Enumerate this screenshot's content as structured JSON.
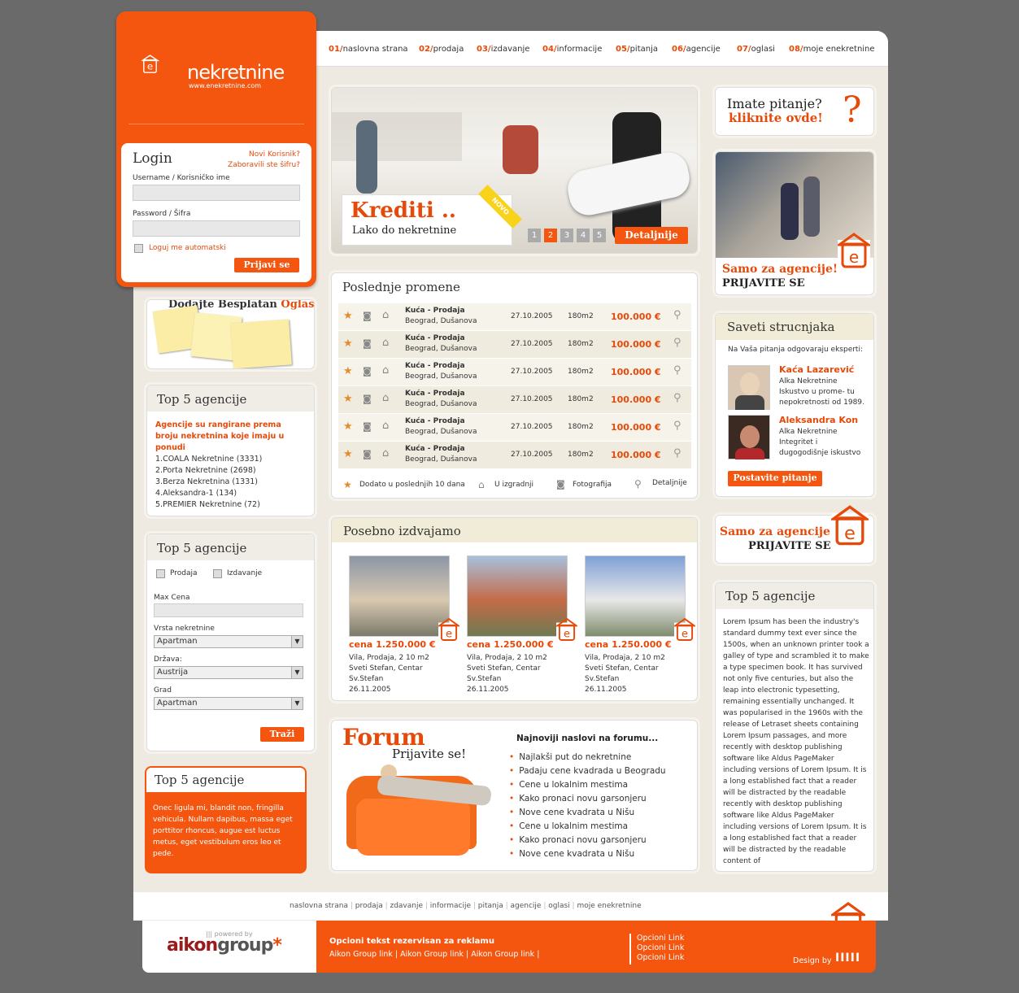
{
  "nav": [
    {
      "num": "01/",
      "label": "naslovna strana"
    },
    {
      "num": "02/",
      "label": "prodaja"
    },
    {
      "num": "03/",
      "label": "izdavanje"
    },
    {
      "num": "04/",
      "label": "informacije"
    },
    {
      "num": "05/",
      "label": "pitanja"
    },
    {
      "num": "06/",
      "label": "agencije"
    },
    {
      "num": "07/",
      "label": "oglasi"
    },
    {
      "num": "08/",
      "label": "moje enekretnine"
    }
  ],
  "logo": {
    "text": "nekretnine",
    "url": "www.enekretnine.com",
    "e": "e"
  },
  "login": {
    "title": "Login",
    "new_user": "Novi Korisnik?",
    "forgot": "Zaboravili ste šifru?",
    "username_label": "Username / Korisničko ime",
    "password_label": "Password / Šifra",
    "auto": "Loguj me automatski",
    "submit": "Prijavi se"
  },
  "ad": {
    "title1": "Dodajte Besplatan",
    "title2": "Oglas"
  },
  "top5a": {
    "title": "Top 5 agencije",
    "intro": "Agencije su rangirane prema broju nekretnina koje imaju u ponudi",
    "items": [
      "1.COALA Nekretnine (3331)",
      "2.Porta Nekretnine (2698)",
      "3.Berza Nekretnina (1331)",
      "4.Aleksandra-1 (134)",
      "5.PREMIER Nekretnine (72)"
    ]
  },
  "search": {
    "title": "Top 5 agencije",
    "prodaja": "Prodaja",
    "izdavanje": "Izdavanje",
    "max_cena": "Max Cena",
    "vrsta": "Vrsta nekretnine",
    "vrsta_val": "Apartman",
    "drzava": "Država:",
    "drzava_val": "Austrija",
    "grad": "Grad",
    "grad_val": "Apartman",
    "submit": "Traži"
  },
  "top5c": {
    "title": "Top 5 agencije",
    "text": "Onec ligula mi, blandit non, fringilla vehicula. Nullam dapibus, massa eget porttitor rhoncus, augue est luctus metus, eget vestibulum eros leo et pede."
  },
  "hero": {
    "title": "Krediti ..",
    "subtitle": "Lako do nekretnine",
    "badge": "NOVO",
    "pages": [
      "1",
      "2",
      "3",
      "4",
      "5"
    ],
    "details": "Detaljnije"
  },
  "latest": {
    "title": "Poslednje promene",
    "rows": [
      {
        "type": "Kuća - Prodaja",
        "loc": "Beograd, Dušanova",
        "date": "27.10.2005",
        "size": "180m2",
        "price": "100.000 €"
      },
      {
        "type": "Kuća - Prodaja",
        "loc": "Beograd, Dušanova",
        "date": "27.10.2005",
        "size": "180m2",
        "price": "100.000 €"
      },
      {
        "type": "Kuća - Prodaja",
        "loc": "Beograd, Dušanova",
        "date": "27.10.2005",
        "size": "180m2",
        "price": "100.000 €"
      },
      {
        "type": "Kuća - Prodaja",
        "loc": "Beograd, Dušanova",
        "date": "27.10.2005",
        "size": "180m2",
        "price": "100.000 €"
      },
      {
        "type": "Kuća - Prodaja",
        "loc": "Beograd, Dušanova",
        "date": "27.10.2005",
        "size": "180m2",
        "price": "100.000 €"
      },
      {
        "type": "Kuća - Prodaja",
        "loc": "Beograd, Dušanova",
        "date": "27.10.2005",
        "size": "180m2",
        "price": "100.000 €"
      }
    ],
    "legend": {
      "new": "Dodato u poslednjih 10 dana",
      "build": "U izgradnji",
      "photo": "Fotografija",
      "detail": "Detaljnije"
    }
  },
  "featured": {
    "title": "Posebno izdvajamo",
    "items": [
      {
        "price": "cena 1.250.000 €",
        "l1": "Vila, Prodaja, 2 10 m2",
        "l2": "Sveti Stefan, Centar",
        "l3": "Sv.Stefan",
        "l4": "26.11.2005"
      },
      {
        "price": "cena 1.250.000 €",
        "l1": "Vila, Prodaja, 2 10 m2",
        "l2": "Sveti Stefan, Centar",
        "l3": "Sv.Stefan",
        "l4": "26.11.2005"
      },
      {
        "price": "cena 1.250.000 €",
        "l1": "Vila, Prodaja, 2 10 m2",
        "l2": "Sveti Stefan, Centar",
        "l3": "Sv.Stefan",
        "l4": "26.11.2005"
      }
    ]
  },
  "forum": {
    "title": "Forum",
    "subtitle": "Prijavite se!",
    "heading": "Najnoviji naslovi na forumu...",
    "items": [
      "Najlakši put do nekretnine",
      "Padaju cene kvadrada u Beogradu",
      "Cene u lokalnim mestima",
      "Kako pronaci novu garsonjeru",
      "Nove cene kvadrata u Nišu",
      "Cene u lokalnim mestima",
      "Kako pronaci novu garsonjeru",
      "Nove cene kvadrata u Nišu"
    ]
  },
  "question": {
    "l1": "Imate pitanje?",
    "l2": "kliknite ovde!"
  },
  "agency_ad": {
    "l1": "Samo za agencije!",
    "l2": "PRIJAVITE SE"
  },
  "experts": {
    "title": "Saveti strucnjaka",
    "intro": "Na Vaša pitanja odgovaraju eksperti:",
    "list": [
      {
        "name": "Kaća Lazarević",
        "l1": "Alka Nekretnine",
        "l2": "Iskustvo u prome- tu",
        "l3": "nepokretnosti od 1989."
      },
      {
        "name": "Aleksandra Kon",
        "l1": "Alka Nekretnine",
        "l2": "Integritet i",
        "l3": "dugogodišnje iskustvo"
      }
    ],
    "button": "Postavite pitanje"
  },
  "agency_ad2": {
    "l1": "Samo za agencije!",
    "l2": "PRIJAVITE SE"
  },
  "top5r": {
    "title": "Top 5 agencije",
    "text": "Lorem Ipsum has been the industry's standard dummy text ever since the 1500s, when an unknown printer took a galley of type and scrambled it to make a type specimen book. It has survived not only five centuries, but also the leap into electronic typesetting, remaining essentially unchanged. It was popularised in the 1960s with the release of Letraset sheets containing Lorem Ipsum passages, and more recently with desktop publishing software like Aldus PageMaker including versions of Lorem Ipsum. It is a long established fact that a reader will be distracted by the readable recently with desktop publishing software like Aldus PageMaker including versions of Lorem Ipsum. It is a long established fact that a reader will be distracted by the readable content of"
  },
  "footer": {
    "links": [
      "naslovna strana",
      "prodaja",
      "zdavanje",
      "informacije",
      "pitanja",
      "agencije",
      "oglasi",
      "moje enekretnine"
    ],
    "powered": "powered by",
    "brand1": "aikon",
    "brand2": "group",
    "star": "*",
    "ad_title": "Opcioni tekst rezervisan za reklamu",
    "ad_links": "Aikon Group link |  Aikon Group link |  Aikon Group link |",
    "opt": [
      "Opcioni Link",
      "Opcioni Link",
      "Opcioni Link"
    ],
    "design": "Design by"
  },
  "colors": {
    "accent": "#f4550f",
    "bg": "#6a6a6a",
    "page": "#eeeae1"
  }
}
